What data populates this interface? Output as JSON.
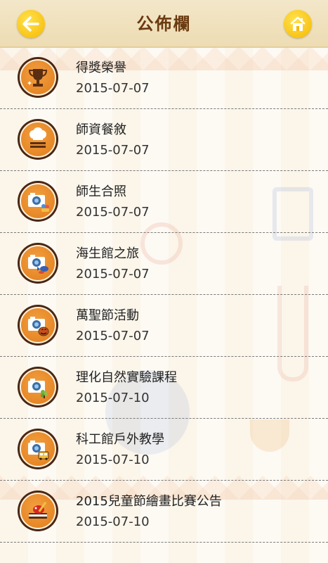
{
  "header": {
    "title": "公佈欄",
    "back_icon": "back-arrow-icon",
    "home_icon": "home-icon"
  },
  "colors": {
    "header_bg": "#f0e1bd",
    "title": "#6b3a10",
    "button": "#f8c400",
    "icon_orange": "#e8862a",
    "icon_ring": "#4a2713"
  },
  "items": [
    {
      "title": "得獎榮譽",
      "date": "2015-07-07",
      "icon": "trophy-icon"
    },
    {
      "title": "師資餐敘",
      "date": "2015-07-07",
      "icon": "chef-hat-icon"
    },
    {
      "title": "師生合照",
      "date": "2015-07-07",
      "icon": "camera-people-icon"
    },
    {
      "title": "海生館之旅",
      "date": "2015-07-07",
      "icon": "camera-fish-icon"
    },
    {
      "title": "萬聖節活動",
      "date": "2015-07-07",
      "icon": "camera-pumpkin-icon"
    },
    {
      "title": "理化自然實驗課程",
      "date": "2015-07-10",
      "icon": "camera-plant-icon"
    },
    {
      "title": "科工館戶外教學",
      "date": "2015-07-10",
      "icon": "camera-bus-icon"
    },
    {
      "title": "2015兒童節繪畫比賽公告",
      "date": "2015-07-10",
      "icon": "painting-book-icon"
    }
  ]
}
